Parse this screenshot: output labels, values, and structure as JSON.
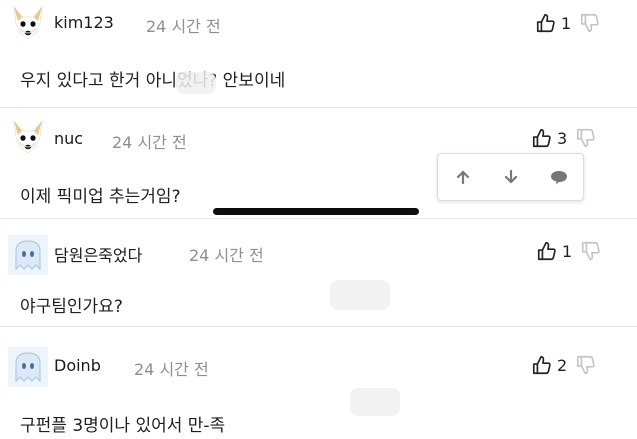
{
  "comments": [
    {
      "username": "kim123",
      "time": "24 시간 전",
      "text": "우지 있다고 한거 아니었나? 안보이네",
      "likes": "1",
      "avatar": "dog-avatar-icon"
    },
    {
      "username": "nuc",
      "time": "24 시간 전",
      "text": "이제 픽미업 추는거임?",
      "likes": "3",
      "avatar": "dog-avatar-icon"
    },
    {
      "username": "담원은죽었다",
      "time": "24 시간 전",
      "text": "야구팀인가요?",
      "likes": "1",
      "avatar": "ghost-avatar-icon"
    },
    {
      "username": "Doinb",
      "time": "24 시간 전",
      "text": "구펀플 3명이나 있어서 만-족",
      "likes": "2",
      "avatar": "ghost-avatar-icon"
    }
  ],
  "popup_menu": {
    "items": [
      "arrow-up-icon",
      "arrow-down-icon",
      "speech-bubble-icon"
    ]
  },
  "colors": {
    "text": "#1e1e1e",
    "meta": "#8f8f8f",
    "divider": "#e6e6e6"
  }
}
